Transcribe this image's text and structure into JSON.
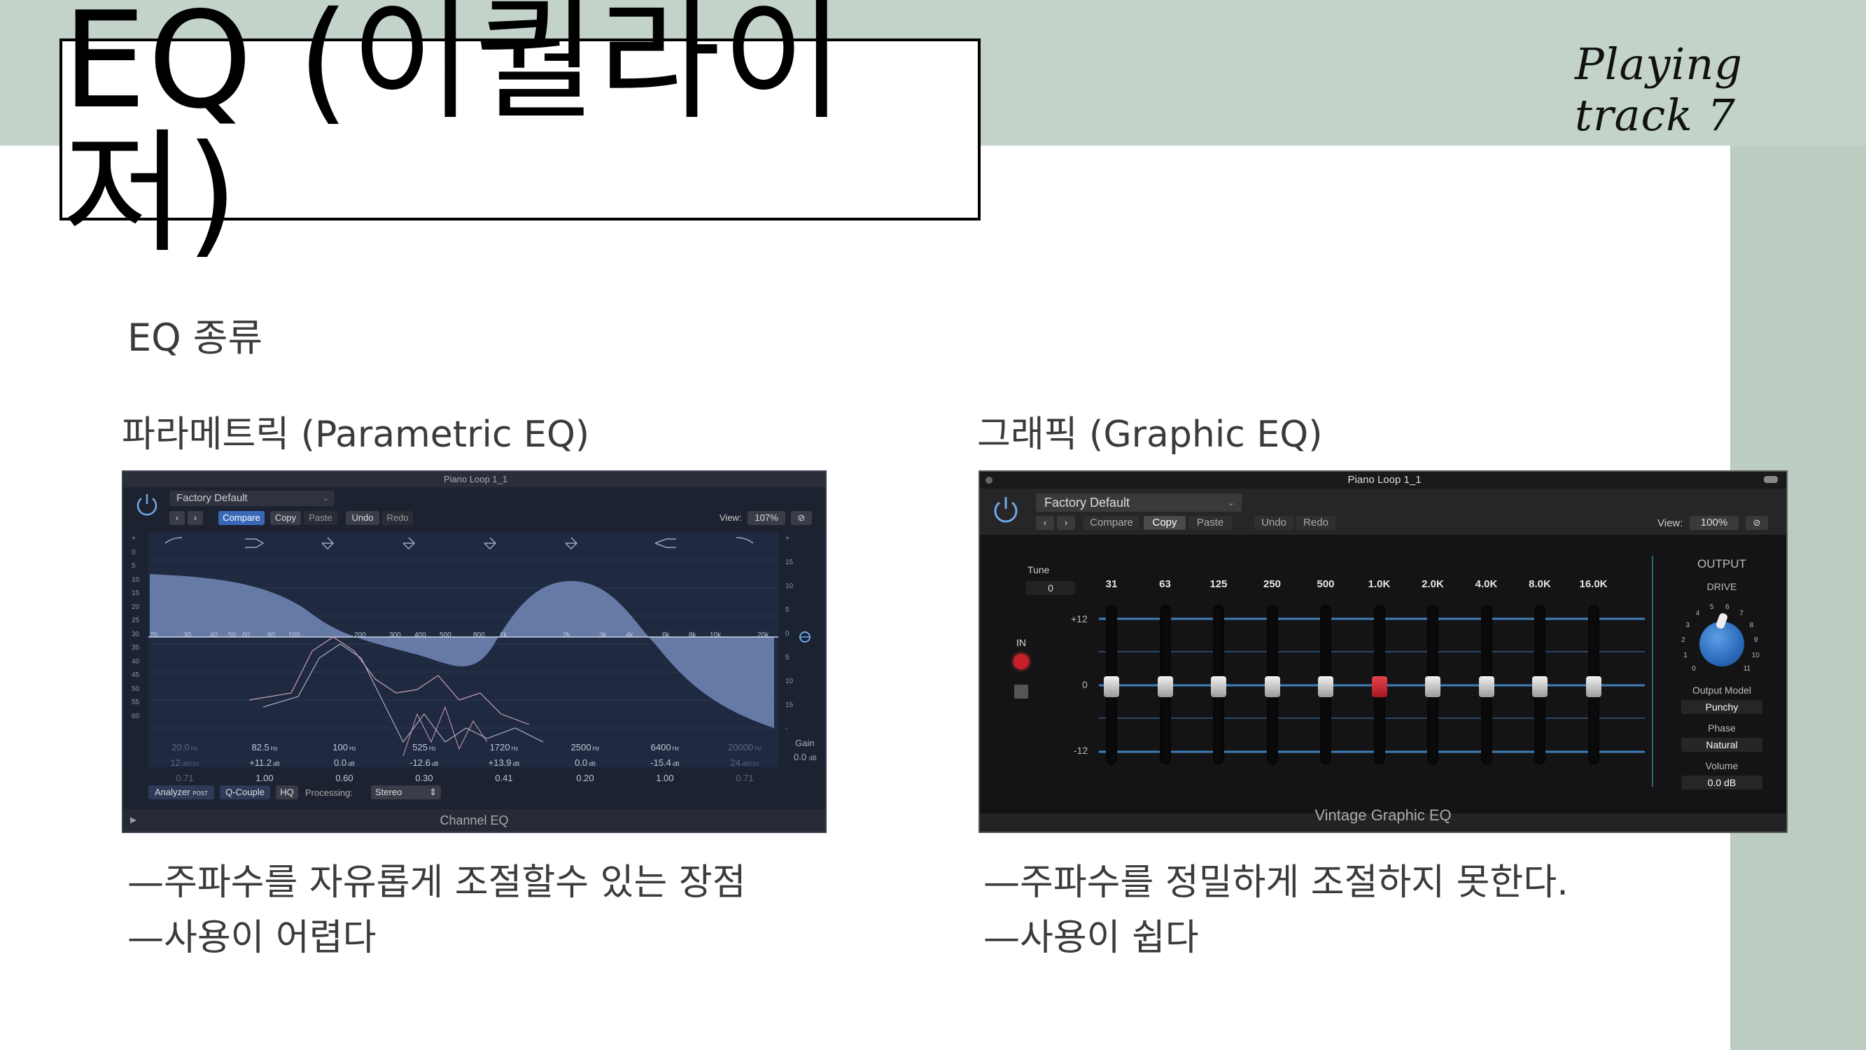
{
  "slide": {
    "title": "EQ (이퀄라이저)",
    "corner_note": "Playing track 7",
    "section_label": "EQ 종류",
    "parametric": {
      "heading": "파라메트릭 (Parametric EQ)",
      "notes": [
        "—주파수를 자유롭게 조절할수 있는 장점",
        "—사용이 어렵다"
      ]
    },
    "graphic": {
      "heading": "그래픽 (Graphic EQ)",
      "notes": [
        "—주파수를 정밀하게 조절하지 못한다.",
        "—사용이 쉽다"
      ]
    }
  },
  "channel_eq": {
    "window_title": "Piano Loop 1_1",
    "preset": "Factory Default",
    "buttons": {
      "compare": "Compare",
      "copy": "Copy",
      "paste": "Paste",
      "undo": "Undo",
      "redo": "Redo"
    },
    "view_label": "View:",
    "view_value": "107%",
    "freq_labels": [
      "20",
      "30",
      "40",
      "50",
      "60",
      "80",
      "100",
      "200",
      "300",
      "400",
      "500",
      "800",
      "1k",
      "2k",
      "3k",
      "4k",
      "6k",
      "8k",
      "10k",
      "20k"
    ],
    "left_scale": [
      "+",
      "0",
      "5",
      "10",
      "15",
      "20",
      "25",
      "30",
      "35",
      "40",
      "45",
      "50",
      "55",
      "60"
    ],
    "right_scale": [
      "+",
      "15",
      "10",
      "5",
      "0",
      "5",
      "10",
      "15",
      "-"
    ],
    "bands": [
      {
        "freq": "20.0",
        "unit": "Hz",
        "gain": "12",
        "gain_unit": "dB/Oct",
        "q": "0.71"
      },
      {
        "freq": "82.5",
        "unit": "Hz",
        "gain": "+11.2",
        "gain_unit": "dB",
        "q": "1.00"
      },
      {
        "freq": "100",
        "unit": "Hz",
        "gain": "0.0",
        "gain_unit": "dB",
        "q": "0.60"
      },
      {
        "freq": "525",
        "unit": "Hz",
        "gain": "-12.6",
        "gain_unit": "dB",
        "q": "0.30"
      },
      {
        "freq": "1720",
        "unit": "Hz",
        "gain": "+13.9",
        "gain_unit": "dB",
        "q": "0.41"
      },
      {
        "freq": "2500",
        "unit": "Hz",
        "gain": "0.0",
        "gain_unit": "dB",
        "q": "0.20"
      },
      {
        "freq": "6400",
        "unit": "Hz",
        "gain": "-15.4",
        "gain_unit": "dB",
        "q": "1.00"
      },
      {
        "freq": "20000",
        "unit": "Hz",
        "gain": "24",
        "gain_unit": "dB/Oct",
        "q": "0.71"
      }
    ],
    "gain_label": "Gain",
    "gain_value": "0.0",
    "gain_unit": "dB",
    "analyzer_label": "Analyzer",
    "analyzer_post": "POST",
    "qcouple_label": "Q-Couple",
    "hq_label": "HQ",
    "processing_label": "Processing:",
    "processing_value": "Stereo",
    "footer": "Channel EQ"
  },
  "graphic_eq": {
    "window_title": "Piano Loop 1_1",
    "preset": "Factory Default",
    "buttons": {
      "compare": "Compare",
      "copy": "Copy",
      "paste": "Paste",
      "undo": "Undo",
      "redo": "Redo"
    },
    "view_label": "View:",
    "view_value": "100%",
    "tune_label": "Tune",
    "tune_value": "0",
    "in_label": "IN",
    "bands": [
      "31",
      "63",
      "125",
      "250",
      "500",
      "1.0K",
      "2.0K",
      "4.0K",
      "8.0K",
      "16.0K"
    ],
    "scale": [
      "+12",
      "0",
      "-12"
    ],
    "output_label": "OUTPUT",
    "drive_label": "DRIVE",
    "drive_ticks": [
      "0",
      "1",
      "2",
      "3",
      "4",
      "5",
      "6",
      "7",
      "8",
      "9",
      "10",
      "11"
    ],
    "output_model_label": "Output Model",
    "output_model_value": "Punchy",
    "phase_label": "Phase",
    "phase_value": "Natural",
    "volume_label": "Volume",
    "volume_value": "0.0 dB",
    "footer": "Vintage Graphic EQ",
    "colors": {
      "accent_red": "#c8202a",
      "line_blue": "#3f7fb8",
      "knob_blue": "#2f6fbf"
    }
  }
}
